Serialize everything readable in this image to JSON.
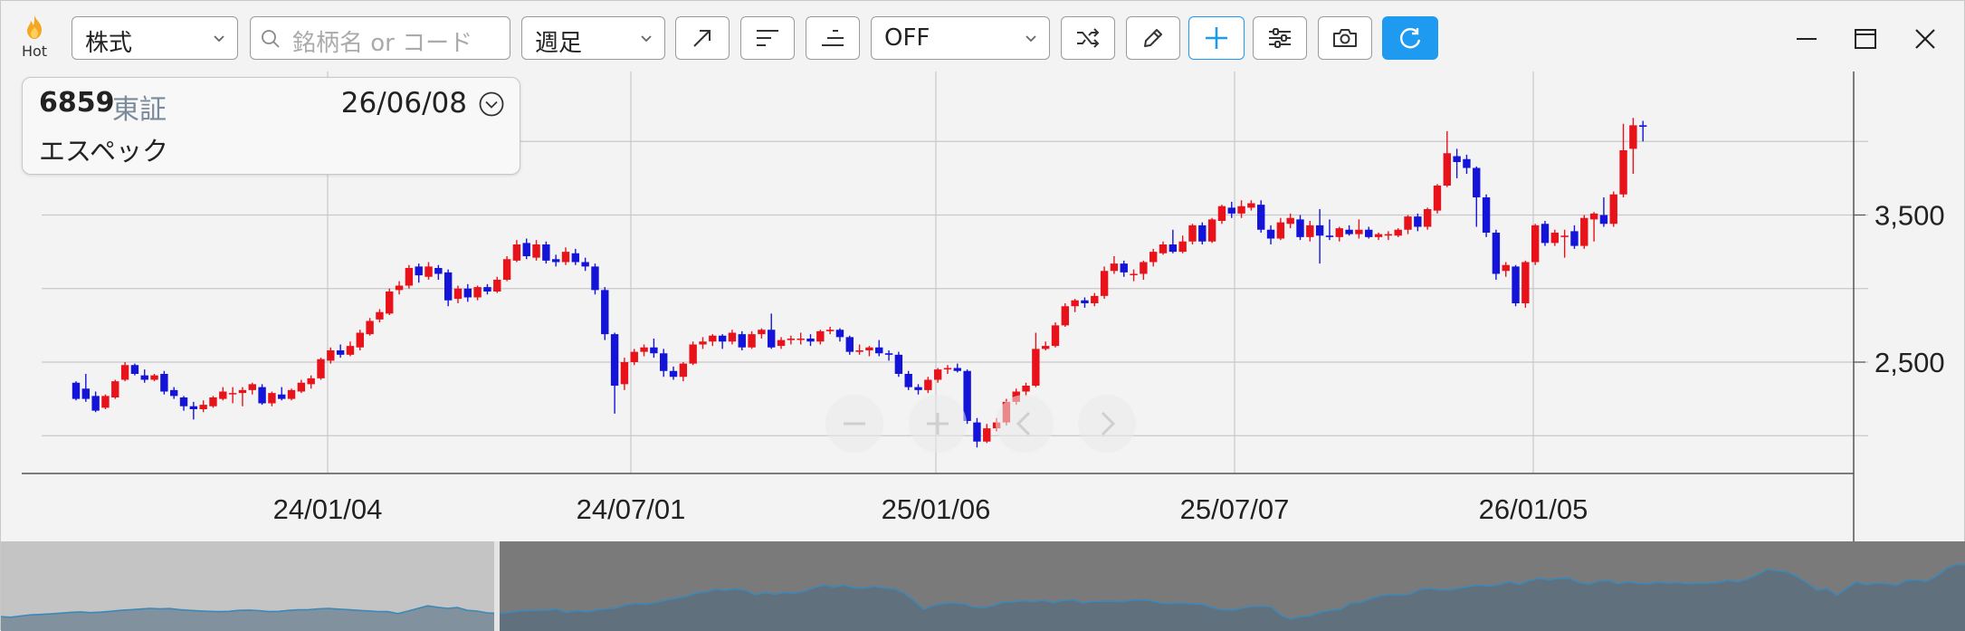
{
  "toolbar": {
    "hot_label": "Hot",
    "market_type": "株式",
    "search_placeholder": "銘柄名 or コード",
    "period": "週足",
    "indicator": "OFF",
    "icons": [
      "trendline-icon",
      "align-left-icon",
      "align-right-icon",
      "shuffle-icon",
      "pencil-icon",
      "add-icon",
      "filter-settings-icon",
      "camera-icon",
      "refresh-icon"
    ],
    "window_icons": [
      "minimize-icon",
      "maximize-icon",
      "close-icon"
    ],
    "accent_color": "#1e9bf0"
  },
  "info": {
    "code": "6859",
    "market": "東証",
    "date": "26/06/08",
    "name": "エスペック"
  },
  "chart_data": {
    "type": "candlestick",
    "title": "",
    "xlabel": "",
    "ylabel": "",
    "x_tick_labels": [
      "24/01/04",
      "24/07/01",
      "25/01/06",
      "25/07/07",
      "26/01/05"
    ],
    "y_tick_labels": [
      "3,500",
      "2,500"
    ],
    "y_ticks": [
      3500,
      2500
    ],
    "ylim": [
      1700,
      4200
    ],
    "grid": true,
    "up_color": "#e8121a",
    "down_color": "#1414d8",
    "candles": [
      [
        2360,
        2250,
        2370,
        2240
      ],
      [
        2320,
        2250,
        2420,
        2230
      ],
      [
        2270,
        2170,
        2300,
        2160
      ],
      [
        2190,
        2270,
        2280,
        2180
      ],
      [
        2260,
        2370,
        2380,
        2250
      ],
      [
        2380,
        2480,
        2500,
        2370
      ],
      [
        2480,
        2420,
        2490,
        2410
      ],
      [
        2410,
        2380,
        2450,
        2360
      ],
      [
        2380,
        2410,
        2420,
        2370
      ],
      [
        2420,
        2300,
        2440,
        2280
      ],
      [
        2310,
        2270,
        2330,
        2250
      ],
      [
        2260,
        2200,
        2270,
        2170
      ],
      [
        2200,
        2180,
        2230,
        2110
      ],
      [
        2180,
        2210,
        2240,
        2160
      ],
      [
        2200,
        2260,
        2270,
        2190
      ],
      [
        2250,
        2300,
        2330,
        2240
      ],
      [
        2290,
        2290,
        2330,
        2220
      ],
      [
        2290,
        2310,
        2330,
        2200
      ],
      [
        2310,
        2350,
        2360,
        2280
      ],
      [
        2330,
        2220,
        2350,
        2210
      ],
      [
        2220,
        2290,
        2300,
        2200
      ],
      [
        2280,
        2250,
        2330,
        2240
      ],
      [
        2250,
        2310,
        2320,
        2240
      ],
      [
        2300,
        2360,
        2380,
        2290
      ],
      [
        2350,
        2390,
        2410,
        2320
      ],
      [
        2390,
        2520,
        2530,
        2380
      ],
      [
        2510,
        2580,
        2600,
        2490
      ],
      [
        2580,
        2550,
        2620,
        2530
      ],
      [
        2550,
        2610,
        2640,
        2540
      ],
      [
        2600,
        2700,
        2720,
        2580
      ],
      [
        2690,
        2780,
        2800,
        2680
      ],
      [
        2790,
        2840,
        2860,
        2770
      ],
      [
        2830,
        2980,
        3000,
        2820
      ],
      [
        2990,
        3020,
        3050,
        2960
      ],
      [
        3020,
        3140,
        3160,
        3000
      ],
      [
        3150,
        3090,
        3170,
        3040
      ],
      [
        3080,
        3150,
        3180,
        3060
      ],
      [
        3140,
        3100,
        3160,
        3060
      ],
      [
        3110,
        2920,
        3130,
        2880
      ],
      [
        2930,
        3000,
        3020,
        2900
      ],
      [
        3000,
        2940,
        3030,
        2910
      ],
      [
        2940,
        3010,
        3020,
        2920
      ],
      [
        3010,
        2980,
        3030,
        2960
      ],
      [
        2980,
        3060,
        3080,
        2970
      ],
      [
        3060,
        3200,
        3220,
        3050
      ],
      [
        3190,
        3300,
        3330,
        3180
      ],
      [
        3310,
        3220,
        3340,
        3200
      ],
      [
        3210,
        3300,
        3330,
        3190
      ],
      [
        3300,
        3190,
        3320,
        3170
      ],
      [
        3200,
        3180,
        3230,
        3150
      ],
      [
        3180,
        3250,
        3280,
        3160
      ],
      [
        3240,
        3180,
        3270,
        3160
      ],
      [
        3180,
        3150,
        3210,
        3120
      ],
      [
        3150,
        2990,
        3170,
        2960
      ],
      [
        2990,
        2690,
        3010,
        2650
      ],
      [
        2690,
        2340,
        2700,
        2150
      ],
      [
        2350,
        2500,
        2530,
        2310
      ],
      [
        2500,
        2570,
        2590,
        2480
      ],
      [
        2570,
        2600,
        2620,
        2540
      ],
      [
        2600,
        2560,
        2660,
        2530
      ],
      [
        2560,
        2440,
        2590,
        2400
      ],
      [
        2440,
        2400,
        2470,
        2380
      ],
      [
        2400,
        2490,
        2500,
        2370
      ],
      [
        2490,
        2620,
        2640,
        2480
      ],
      [
        2620,
        2640,
        2670,
        2590
      ],
      [
        2640,
        2680,
        2690,
        2610
      ],
      [
        2680,
        2640,
        2690,
        2590
      ],
      [
        2640,
        2700,
        2720,
        2620
      ],
      [
        2690,
        2600,
        2710,
        2580
      ],
      [
        2600,
        2690,
        2710,
        2590
      ],
      [
        2690,
        2720,
        2730,
        2660
      ],
      [
        2720,
        2600,
        2830,
        2590
      ],
      [
        2610,
        2650,
        2670,
        2590
      ],
      [
        2650,
        2660,
        2680,
        2620
      ],
      [
        2660,
        2660,
        2700,
        2620
      ],
      [
        2660,
        2640,
        2690,
        2610
      ],
      [
        2640,
        2710,
        2720,
        2620
      ],
      [
        2710,
        2720,
        2740,
        2690
      ],
      [
        2720,
        2670,
        2730,
        2640
      ],
      [
        2670,
        2570,
        2680,
        2550
      ],
      [
        2570,
        2580,
        2620,
        2550
      ],
      [
        2580,
        2600,
        2610,
        2540
      ],
      [
        2600,
        2560,
        2650,
        2540
      ],
      [
        2560,
        2550,
        2580,
        2510
      ],
      [
        2550,
        2420,
        2570,
        2400
      ],
      [
        2420,
        2330,
        2440,
        2310
      ],
      [
        2330,
        2310,
        2350,
        2280
      ],
      [
        2310,
        2380,
        2400,
        2290
      ],
      [
        2380,
        2450,
        2460,
        2360
      ],
      [
        2450,
        2460,
        2480,
        2420
      ],
      [
        2460,
        2440,
        2490,
        2430
      ],
      [
        2440,
        2100,
        2450,
        2080
      ],
      [
        2090,
        1960,
        2120,
        1920
      ],
      [
        1960,
        2050,
        2080,
        1950
      ],
      [
        2050,
        2090,
        2120,
        2030
      ],
      [
        2090,
        2230,
        2250,
        2070
      ],
      [
        2230,
        2300,
        2320,
        2210
      ],
      [
        2300,
        2340,
        2360,
        2270
      ],
      [
        2340,
        2590,
        2700,
        2330
      ],
      [
        2590,
        2610,
        2640,
        2580
      ],
      [
        2610,
        2750,
        2770,
        2600
      ],
      [
        2750,
        2880,
        2900,
        2740
      ],
      [
        2880,
        2920,
        2930,
        2840
      ],
      [
        2920,
        2900,
        2940,
        2870
      ],
      [
        2900,
        2950,
        2970,
        2880
      ],
      [
        2950,
        3120,
        3150,
        2930
      ],
      [
        3120,
        3170,
        3220,
        3100
      ],
      [
        3170,
        3110,
        3190,
        3080
      ],
      [
        3100,
        3100,
        3130,
        3050
      ],
      [
        3100,
        3180,
        3190,
        3060
      ],
      [
        3180,
        3250,
        3270,
        3150
      ],
      [
        3240,
        3300,
        3320,
        3230
      ],
      [
        3300,
        3250,
        3400,
        3240
      ],
      [
        3250,
        3320,
        3360,
        3240
      ],
      [
        3320,
        3430,
        3440,
        3300
      ],
      [
        3430,
        3320,
        3450,
        3300
      ],
      [
        3320,
        3470,
        3480,
        3310
      ],
      [
        3460,
        3560,
        3570,
        3440
      ],
      [
        3550,
        3510,
        3590,
        3480
      ],
      [
        3510,
        3560,
        3600,
        3480
      ],
      [
        3550,
        3580,
        3600,
        3530
      ],
      [
        3570,
        3400,
        3600,
        3380
      ],
      [
        3400,
        3340,
        3430,
        3300
      ],
      [
        3340,
        3450,
        3480,
        3330
      ],
      [
        3440,
        3480,
        3510,
        3410
      ],
      [
        3470,
        3350,
        3500,
        3330
      ],
      [
        3350,
        3430,
        3460,
        3320
      ],
      [
        3430,
        3360,
        3540,
        3170
      ],
      [
        3360,
        3350,
        3470,
        3330
      ],
      [
        3350,
        3410,
        3420,
        3320
      ],
      [
        3400,
        3370,
        3430,
        3360
      ],
      [
        3370,
        3400,
        3470,
        3340
      ],
      [
        3400,
        3350,
        3420,
        3340
      ],
      [
        3350,
        3370,
        3380,
        3330
      ],
      [
        3360,
        3370,
        3390,
        3330
      ],
      [
        3360,
        3400,
        3410,
        3350
      ],
      [
        3400,
        3490,
        3500,
        3370
      ],
      [
        3490,
        3420,
        3510,
        3390
      ],
      [
        3420,
        3540,
        3550,
        3400
      ],
      [
        3530,
        3700,
        3710,
        3510
      ],
      [
        3700,
        3920,
        4070,
        3690
      ],
      [
        3900,
        3860,
        3950,
        3750
      ],
      [
        3880,
        3820,
        3910,
        3780
      ],
      [
        3820,
        3620,
        3830,
        3420
      ],
      [
        3620,
        3380,
        3640,
        3350
      ],
      [
        3380,
        3100,
        3400,
        3060
      ],
      [
        3120,
        3160,
        3180,
        3080
      ],
      [
        3150,
        2900,
        3160,
        2880
      ],
      [
        2900,
        3180,
        3190,
        2870
      ],
      [
        3180,
        3430,
        3440,
        3160
      ],
      [
        3440,
        3310,
        3460,
        3290
      ],
      [
        3310,
        3380,
        3400,
        3290
      ],
      [
        3350,
        3360,
        3400,
        3210
      ],
      [
        3390,
        3290,
        3430,
        3270
      ],
      [
        3290,
        3480,
        3500,
        3270
      ],
      [
        3470,
        3510,
        3520,
        3320
      ],
      [
        3500,
        3440,
        3620,
        3420
      ],
      [
        3440,
        3640,
        3660,
        3420
      ],
      [
        3640,
        3940,
        4120,
        3620
      ],
      [
        3950,
        4110,
        4160,
        3780
      ],
      [
        4110,
        4100,
        4140,
        4000
      ]
    ]
  }
}
